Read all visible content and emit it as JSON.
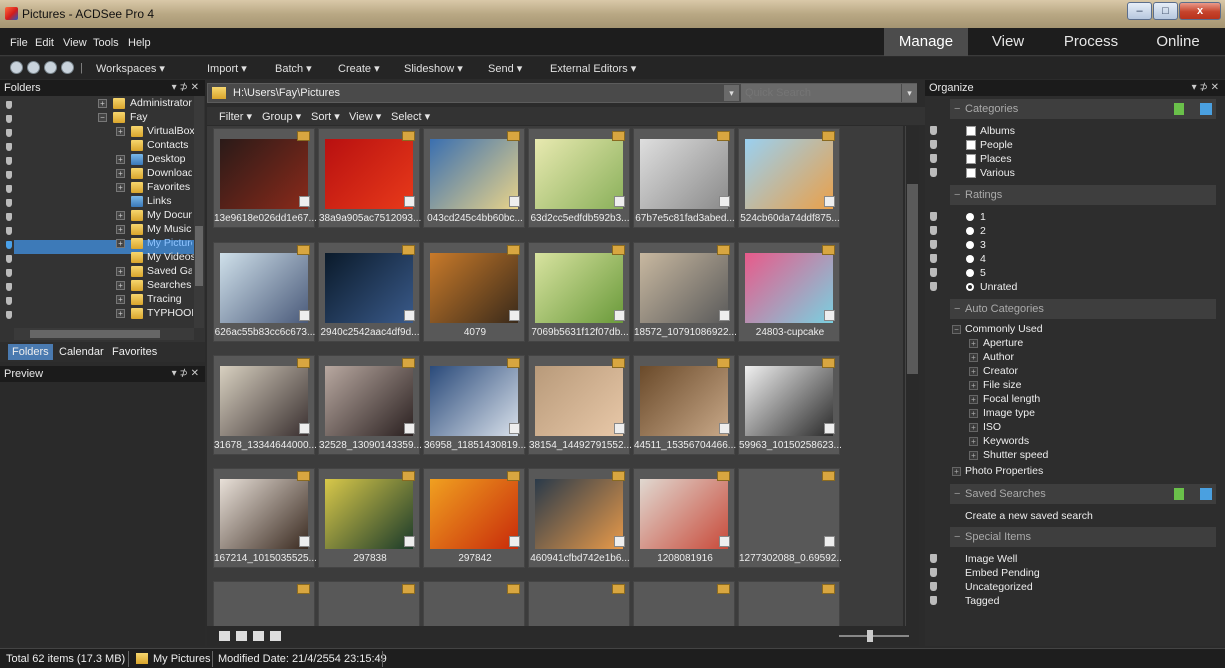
{
  "window": {
    "title": "Pictures - ACDSee Pro 4",
    "minimize": "–",
    "maximize": "□",
    "close": "x"
  },
  "menu": [
    "File",
    "Edit",
    "View",
    "Tools",
    "Help"
  ],
  "modes": [
    "Manage",
    "View",
    "Process",
    "Online"
  ],
  "toolbar": [
    "Workspaces ▾",
    "Import ▾",
    "Batch ▾",
    "Create ▾",
    "Slideshow ▾",
    "Send ▾",
    "External Editors ▾"
  ],
  "folders": {
    "title": "Folders",
    "controls": "▾ ⊅ ✕",
    "items": [
      "Administrator",
      "Fay",
      "VirtualBox",
      "Contacts",
      "Desktop",
      "Downloads",
      "Favorites",
      "Links",
      "My Documents",
      "My Music",
      "My Pictures",
      "My Videos",
      "Saved Games",
      "Searches",
      "Tracing",
      "TYPHOON"
    ],
    "tabs": [
      "Folders",
      "Calendar",
      "Favorites"
    ]
  },
  "preview": {
    "title": "Preview",
    "controls": "▾ ⊅ ✕"
  },
  "address": {
    "path": "H:\\Users\\Fay\\Pictures",
    "search_placeholder": "Quick Search"
  },
  "filterbar": [
    "Filter ▾",
    "Group ▾",
    "Sort ▾",
    "View ▾",
    "Select ▾"
  ],
  "thumbnails": [
    {
      "caption": "13e9618e026dd1e67...",
      "c1": "#2a1a18",
      "c2": "#8a2a1a"
    },
    {
      "caption": "38a9a905ac7512093...",
      "c1": "#b81010",
      "c2": "#e83a1a"
    },
    {
      "caption": "043cd245c4bb60bc...",
      "c1": "#3a6fb0",
      "c2": "#e8d38a"
    },
    {
      "caption": "63d2cc5edfdb592b3...",
      "c1": "#e8e9b0",
      "c2": "#8ab05a"
    },
    {
      "caption": "67b7e5c81fad3abed...",
      "c1": "#dedede",
      "c2": "#8a8a8a"
    },
    {
      "caption": "524cb60da74ddf875...",
      "c1": "#9ad0f0",
      "c2": "#e9a04a"
    },
    {
      "caption": "626ac55b83cc6c673...",
      "c1": "#cfe0ea",
      "c2": "#4a5a7a"
    },
    {
      "caption": "2940c2542aac4df9d...",
      "c1": "#0a1a2a",
      "c2": "#3a5a8a"
    },
    {
      "caption": "4079",
      "c1": "#c87a2a",
      "c2": "#3a2a1a"
    },
    {
      "caption": "7069b5631f12f07db...",
      "c1": "#d8e3a0",
      "c2": "#6a9a3a"
    },
    {
      "caption": "18572_10791086922...",
      "c1": "#c8b8a0",
      "c2": "#5a5a5a"
    },
    {
      "caption": "24803-cupcake",
      "c1": "#e85a8a",
      "c2": "#7ad0e0"
    },
    {
      "caption": "31678_13344644000...",
      "c1": "#d8d0c0",
      "c2": "#3a3030"
    },
    {
      "caption": "32528_13090143359...",
      "c1": "#b8a8a0",
      "c2": "#2a2020"
    },
    {
      "caption": "36958_11851430819...",
      "c1": "#2a4a7a",
      "c2": "#d8e0ea"
    },
    {
      "caption": "38154_14492791552...",
      "c1": "#b89a7a",
      "c2": "#e8c8a8"
    },
    {
      "caption": "44511_15356704466...",
      "c1": "#6a4a2a",
      "c2": "#c8a888"
    },
    {
      "caption": "59963_10150258623...",
      "c1": "#f0f0f0",
      "c2": "#2a2a2a"
    },
    {
      "caption": "167214_1015035525...",
      "c1": "#e8e0d8",
      "c2": "#3a2a20"
    },
    {
      "caption": "297838",
      "c1": "#d8c84a",
      "c2": "#1a3a2a"
    },
    {
      "caption": "297842",
      "c1": "#f0a020",
      "c2": "#c82a0a"
    },
    {
      "caption": "460941cfbd742e1b6...",
      "c1": "#2a3a4a",
      "c2": "#e89a4a"
    },
    {
      "caption": "1208081916",
      "c1": "#e0d8d0",
      "c2": "#c84a3a"
    },
    {
      "caption": "1277302088_0.69592...",
      "c1": "#585858",
      "c2": "#585858"
    }
  ],
  "organize": {
    "title": "Organize",
    "controls": "▾ ⊅ ✕",
    "categories_header": "Categories",
    "categories": [
      "Albums",
      "People",
      "Places",
      "Various"
    ],
    "ratings_header": "Ratings",
    "ratings": [
      "1",
      "2",
      "3",
      "4",
      "5",
      "Unrated"
    ],
    "auto_header": "Auto Categories",
    "auto_root": "Commonly Used",
    "auto_items": [
      "Aperture",
      "Author",
      "Creator",
      "File size",
      "Focal length",
      "Image type",
      "ISO",
      "Keywords",
      "Shutter speed"
    ],
    "photo_props": "Photo Properties",
    "saved_header": "Saved Searches",
    "saved_link": "Create a new saved search",
    "special_header": "Special Items",
    "special_items": [
      "Image Well",
      "Embed Pending",
      "Uncategorized",
      "Tagged"
    ]
  },
  "status": {
    "total": "Total 62 items  (17.3 MB)",
    "folder": "My Pictures",
    "modified": "Modified Date: 21/4/2554 23:15:49"
  }
}
